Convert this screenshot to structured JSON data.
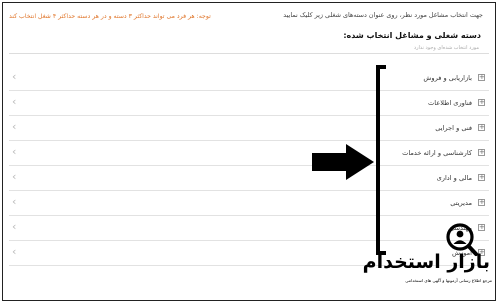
{
  "intro_text": "جهت انتخاب مشاغل مورد نظر، روی عنوان دسته‌های شغلی زیر کلیک نمایید",
  "note_text": "توجه: هر فرد می تواند حداکثر ۳ دسته و در هر دسته حداکثر ۴ شغل انتخاب کند",
  "section_title": "دسته شغلی و مشاغل انتخاب شده:",
  "selected_empty": "مورد انتخاب شده‌ای وجود ندارد",
  "categories": [
    {
      "label": "بازاریابی و فروش"
    },
    {
      "label": "فناوری اطلاعات"
    },
    {
      "label": "فنی و اجرایی"
    },
    {
      "label": "کارشناسی و ارائه خدمات"
    },
    {
      "label": "مالی و اداری"
    },
    {
      "label": "مدیریتی"
    },
    {
      "label": "مهندسی"
    },
    {
      "label": "آموزش"
    }
  ],
  "watermark": {
    "name": "بازار استخدام",
    "tagline": "مرجع اطلاع رسانی آزمونها و آگهی های استخدامی"
  },
  "colors": {
    "note": "#e0752a",
    "annotation": "#000000"
  }
}
